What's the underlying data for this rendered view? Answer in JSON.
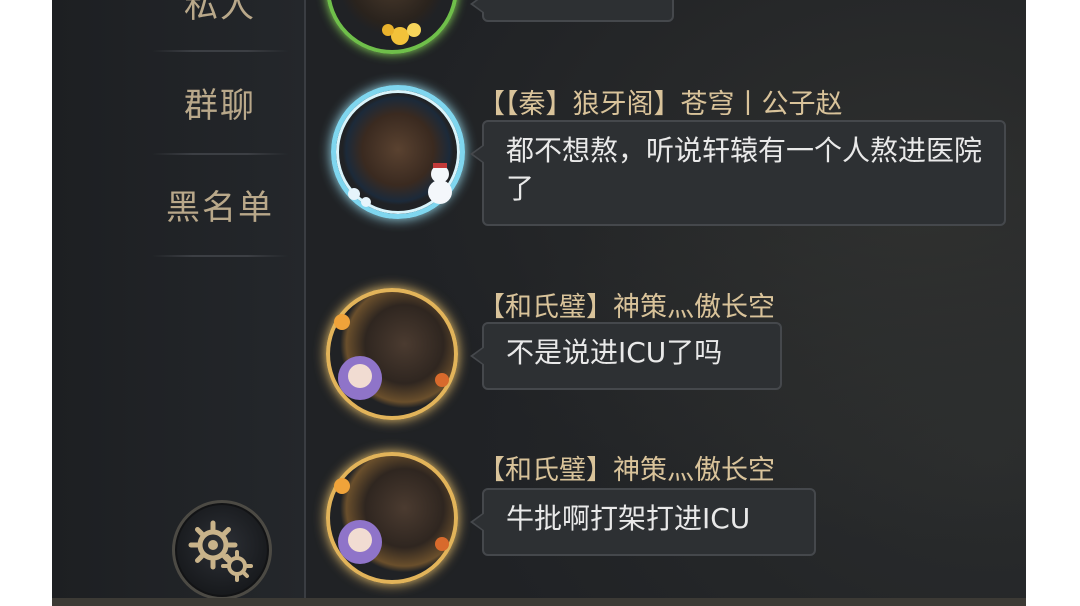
{
  "sidebar": {
    "items": [
      {
        "label": "私人"
      },
      {
        "label": "群聊"
      },
      {
        "label": "黑名单"
      }
    ]
  },
  "messages": [
    {
      "sender": "",
      "text": ""
    },
    {
      "sender": "【【秦】狼牙阁】苍穹丨公子赵",
      "text": "都不想熬，听说轩辕有一个人熬进医院了"
    },
    {
      "sender": "【和氏璧】神策灬傲长空",
      "text": "不是说进ICU了吗"
    },
    {
      "sender": "【和氏璧】神策灬傲长空",
      "text": "牛批啊打架打进ICU"
    }
  ],
  "colors": {
    "name": "#d9c39a",
    "bubble_bg": "#2d3033",
    "bubble_border": "#45484c",
    "sidebar_text": "#b9a88a"
  },
  "icons": {
    "settings": "gear-icon"
  }
}
